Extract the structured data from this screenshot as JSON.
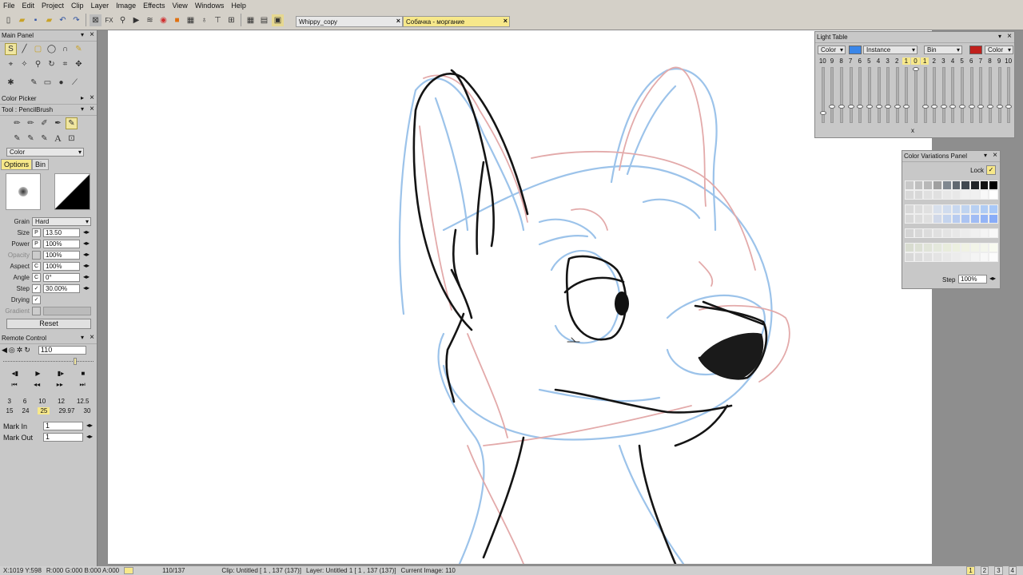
{
  "menu": [
    "File",
    "Edit",
    "Project",
    "Clip",
    "Layer",
    "Image",
    "Effects",
    "View",
    "Windows",
    "Help"
  ],
  "tabs": [
    {
      "label": "Whippy_copy"
    },
    {
      "label": "Собачка - моргание"
    }
  ],
  "main_panel": {
    "title": "Main Panel"
  },
  "color_picker": {
    "title": "Color Picker"
  },
  "tool_panel": {
    "title": "Tool : PencilBrush",
    "color_mode": "Color",
    "tabs": [
      "Options",
      "Bin"
    ],
    "grain_label": "Grain",
    "grain_value": "Hard",
    "props": [
      {
        "label": "Size",
        "mode": "P",
        "value": "13.50"
      },
      {
        "label": "Power",
        "mode": "P",
        "value": "100%"
      },
      {
        "label": "Opacity",
        "mode": "",
        "value": "100%"
      },
      {
        "label": "Aspect",
        "mode": "C",
        "value": "100%"
      },
      {
        "label": "Angle",
        "mode": "C",
        "value": "0°"
      },
      {
        "label": "Step",
        "mode": "✓",
        "value": "30.00%"
      }
    ],
    "drying_label": "Drying",
    "gradient_label": "Gradient",
    "reset_label": "Reset"
  },
  "remote_control": {
    "title": "Remote Control",
    "frame_value": "110",
    "fps_row1": [
      "3",
      "6",
      "10",
      "12",
      "12.5"
    ],
    "fps_row2": [
      "15",
      "24",
      "25",
      "29.97",
      "30"
    ],
    "fps_selected": "25",
    "mark_in_label": "Mark In",
    "mark_in_value": "1",
    "mark_out_label": "Mark Out",
    "mark_out_value": "1"
  },
  "light_table": {
    "title": "Light Table",
    "dd_color": "Color",
    "dd_instance": "Instance",
    "dd_bin": "Bin",
    "dd_color2": "Color",
    "accent_left": "#3a86e8",
    "accent_right": "#c0201c",
    "numbers": [
      "10",
      "9",
      "8",
      "7",
      "6",
      "5",
      "4",
      "3",
      "2",
      "1",
      "0",
      "1",
      "2",
      "3",
      "4",
      "5",
      "6",
      "7",
      "8",
      "9",
      "10"
    ],
    "center_marker": "x"
  },
  "color_variations": {
    "title": "Color Variations Panel",
    "lock_label": "Lock",
    "step_label": "Step",
    "step_value": "100%"
  },
  "status": {
    "coords": "X:1019 Y:598",
    "rgba": "R:000 G:000 B:000 A:000",
    "frame": "110/137",
    "clip": "Clip: Untitled [ 1 , 137  (137)]",
    "layer": "Layer: Untitled 1 [ 1 , 137  (137)]",
    "current": "Current Image: 110",
    "pages": [
      "1",
      "2",
      "3",
      "4"
    ]
  }
}
